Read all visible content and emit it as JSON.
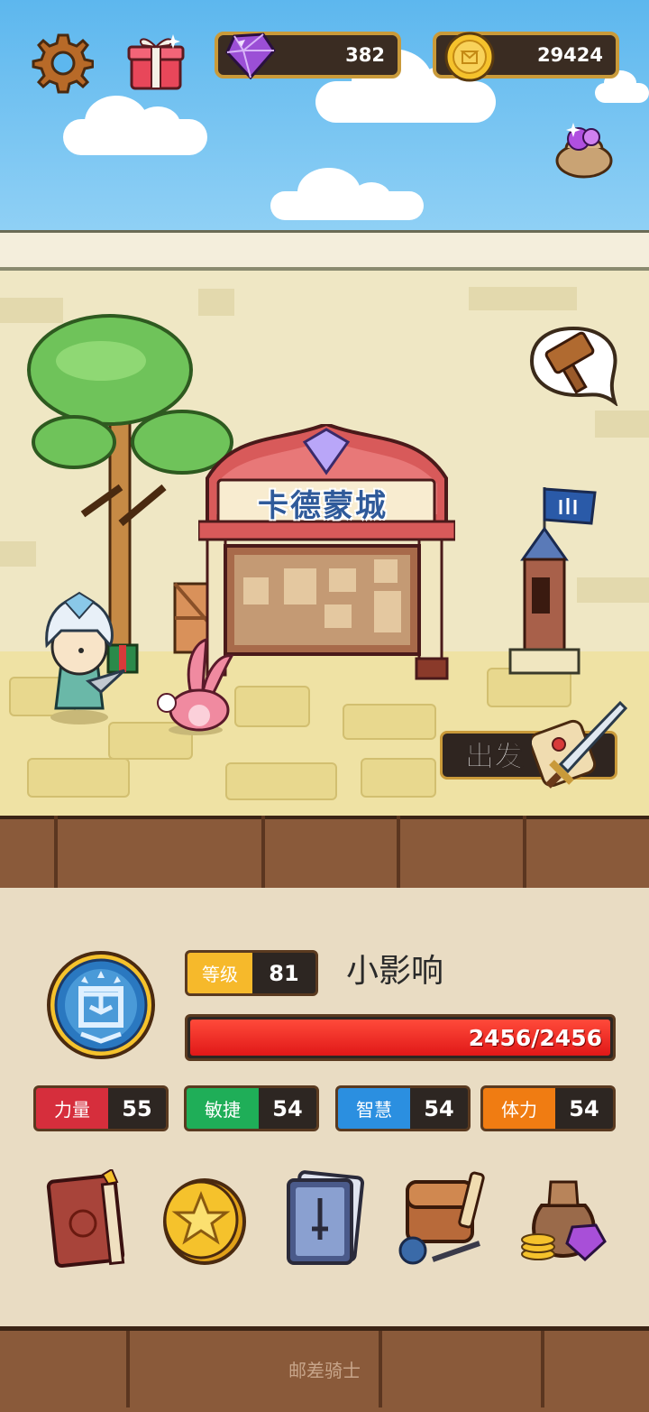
{
  "hud": {
    "gems": "382",
    "coins": "29424",
    "icons": [
      "gear-icon",
      "gift-icon",
      "gem-icon",
      "coin-icon",
      "gem-bag-icon"
    ]
  },
  "scene": {
    "town_sign": "卡德蒙城",
    "depart_label": "出发"
  },
  "character": {
    "rank_icon": "rank-medal-bing",
    "level_label": "等级",
    "level": "81",
    "name": "小影响",
    "hp_text": "2456/2456",
    "hp_fraction": 1.0,
    "stats": [
      {
        "label": "力量",
        "value": "55",
        "color": "#d62e3c"
      },
      {
        "label": "敏捷",
        "value": "54",
        "color": "#1fae58"
      },
      {
        "label": "智慧",
        "value": "54",
        "color": "#2b8fe0"
      },
      {
        "label": "体力",
        "value": "54",
        "color": "#f07c12"
      }
    ]
  },
  "menu": {
    "icons": [
      "book-icon",
      "star-coin-icon",
      "card-deck-icon",
      "backpack-icon",
      "treasure-bag-icon"
    ]
  },
  "footer": {
    "app_name": "邮差骑士"
  },
  "colors": {
    "sky": "#5db7ee",
    "panel": "#e9dcc3",
    "gold_border": "#c99a3a",
    "hp_red": "#e01818"
  }
}
